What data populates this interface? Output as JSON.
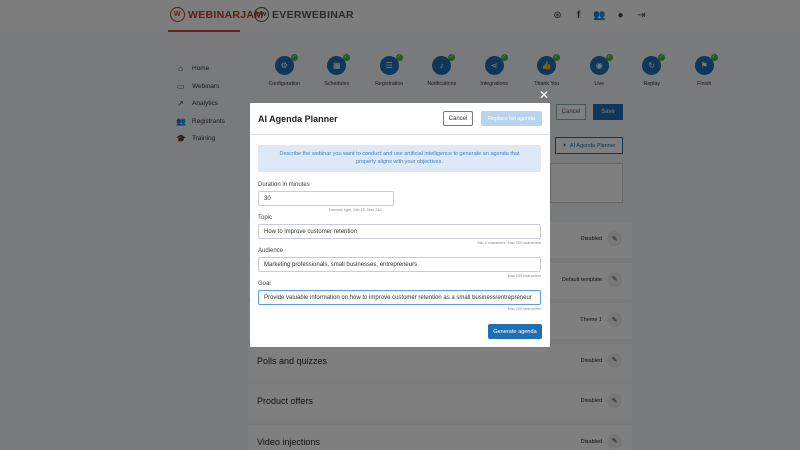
{
  "header": {
    "brand_webinarjam": "WEBINARJAM",
    "brand_everwebinar": "EVERWEBINAR",
    "icons": [
      "support-icon",
      "facebook-icon",
      "community-icon",
      "account-icon",
      "logout-icon"
    ]
  },
  "sidebar": {
    "items": [
      {
        "label": "Home",
        "icon": "home-icon"
      },
      {
        "label": "Webinars",
        "icon": "monitor-icon"
      },
      {
        "label": "Analytics",
        "icon": "analytics-icon"
      },
      {
        "label": "Registrants",
        "icon": "people-icon"
      },
      {
        "label": "Training",
        "icon": "graduation-cap-icon"
      }
    ]
  },
  "steps": [
    {
      "label": "Configuration",
      "icon": "gear-icon"
    },
    {
      "label": "Schedules",
      "icon": "calendar-icon"
    },
    {
      "label": "Registration",
      "icon": "form-icon"
    },
    {
      "label": "Notifications",
      "icon": "bell-icon"
    },
    {
      "label": "Integrations",
      "icon": "share-icon"
    },
    {
      "label": "Thank You",
      "icon": "thumbs-up-icon"
    },
    {
      "label": "Live",
      "icon": "broadcast-icon"
    },
    {
      "label": "Replay",
      "icon": "replay-icon"
    },
    {
      "label": "Finish",
      "icon": "flag-icon"
    }
  ],
  "page_actions": {
    "cancel": "Cancel",
    "save": "Save",
    "ai_planner": "AI Agenda Planner"
  },
  "cards": [
    {
      "title": "",
      "status": "Disabled"
    },
    {
      "title": "",
      "status": "Default template"
    },
    {
      "title": "",
      "status": "Theme 1"
    },
    {
      "title": "Polls and quizzes",
      "status": "Disabled"
    },
    {
      "title": "Product offers",
      "status": "Disabled"
    },
    {
      "title": "Video injections",
      "status": "Disabled"
    }
  ],
  "modal": {
    "title": "AI Agenda Planner",
    "cancel": "Cancel",
    "replace": "Replace full agenda",
    "info_line1": "Describe the webinar you want to conduct and use artificial intelligence to generate an agenda that",
    "info_line2": "properly aligns with your objectives.",
    "duration": {
      "label": "Duration in minutes",
      "value": "30",
      "hint": "Numeric type, Min 15, Max 240"
    },
    "topic": {
      "label": "Topic",
      "value": "How to improve customer retention",
      "hint": "Min 3 characters, Max 100 characters"
    },
    "audience": {
      "label": "Audience",
      "value": "Marketing professionals, small businesses, entrepreneurs",
      "hint": "Max 100 characters"
    },
    "goal": {
      "label": "Goal",
      "value": "Provide valuable information on how to improve customer retention as a small business/entrepreneur",
      "hint": "Max 200 characters"
    },
    "generate": "Generate agenda"
  }
}
